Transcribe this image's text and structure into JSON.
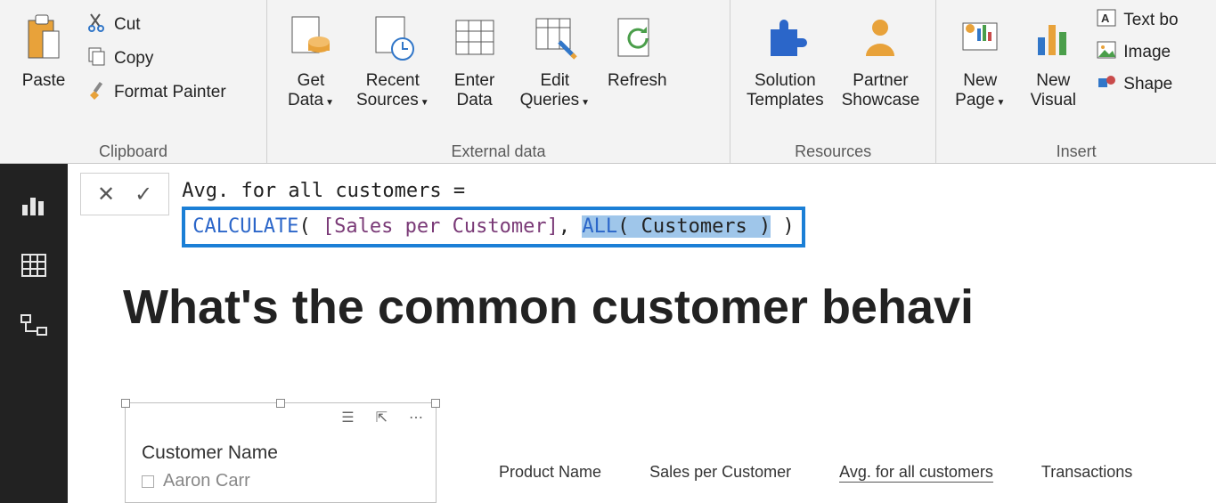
{
  "ribbon": {
    "groups": {
      "clipboard": {
        "label": "Clipboard",
        "paste": "Paste",
        "cut": "Cut",
        "copy": "Copy",
        "format_painter": "Format Painter"
      },
      "external_data": {
        "label": "External data",
        "get_data": "Get\nData",
        "recent_sources": "Recent\nSources",
        "enter_data": "Enter\nData",
        "edit_queries": "Edit\nQueries",
        "refresh": "Refresh"
      },
      "resources": {
        "label": "Resources",
        "solution_templates": "Solution\nTemplates",
        "partner_showcase": "Partner\nShowcase"
      },
      "insert": {
        "label": "Insert",
        "new_page": "New\nPage",
        "new_visual": "New\nVisual",
        "text_box": "Text bo",
        "image": "Image",
        "shapes": "Shape"
      }
    }
  },
  "formula": {
    "line1": "Avg. for all customers =",
    "calc": "CALCULATE",
    "measure": "[Sales per Customer]",
    "all": "ALL",
    "allarg": "Customers"
  },
  "canvas": {
    "title": "What's the common customer behavi"
  },
  "slicer": {
    "header": "Customer Name",
    "item1": "Aaron Carr"
  },
  "columns": {
    "c1": "Product Name",
    "c2": "Sales per Customer",
    "c3": "Avg. for all customers",
    "c4": "Transactions"
  }
}
